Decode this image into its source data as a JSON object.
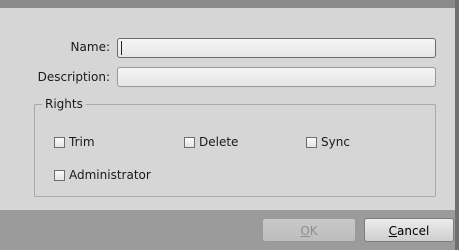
{
  "form": {
    "name_label": "Name:",
    "name_value": "",
    "description_label": "Description:",
    "description_value": ""
  },
  "rights": {
    "title": "Rights",
    "items": [
      {
        "label": "Trim",
        "checked": false
      },
      {
        "label": "Delete",
        "checked": false
      },
      {
        "label": "Sync",
        "checked": false
      },
      {
        "label": "Administrator",
        "checked": false
      }
    ]
  },
  "buttons": {
    "ok_label": "OK",
    "ok_enabled": false,
    "cancel_label": "Cancel"
  },
  "colors": {
    "dialog_bg": "#d6d6d6",
    "footer_bg": "#9b9b9b"
  }
}
